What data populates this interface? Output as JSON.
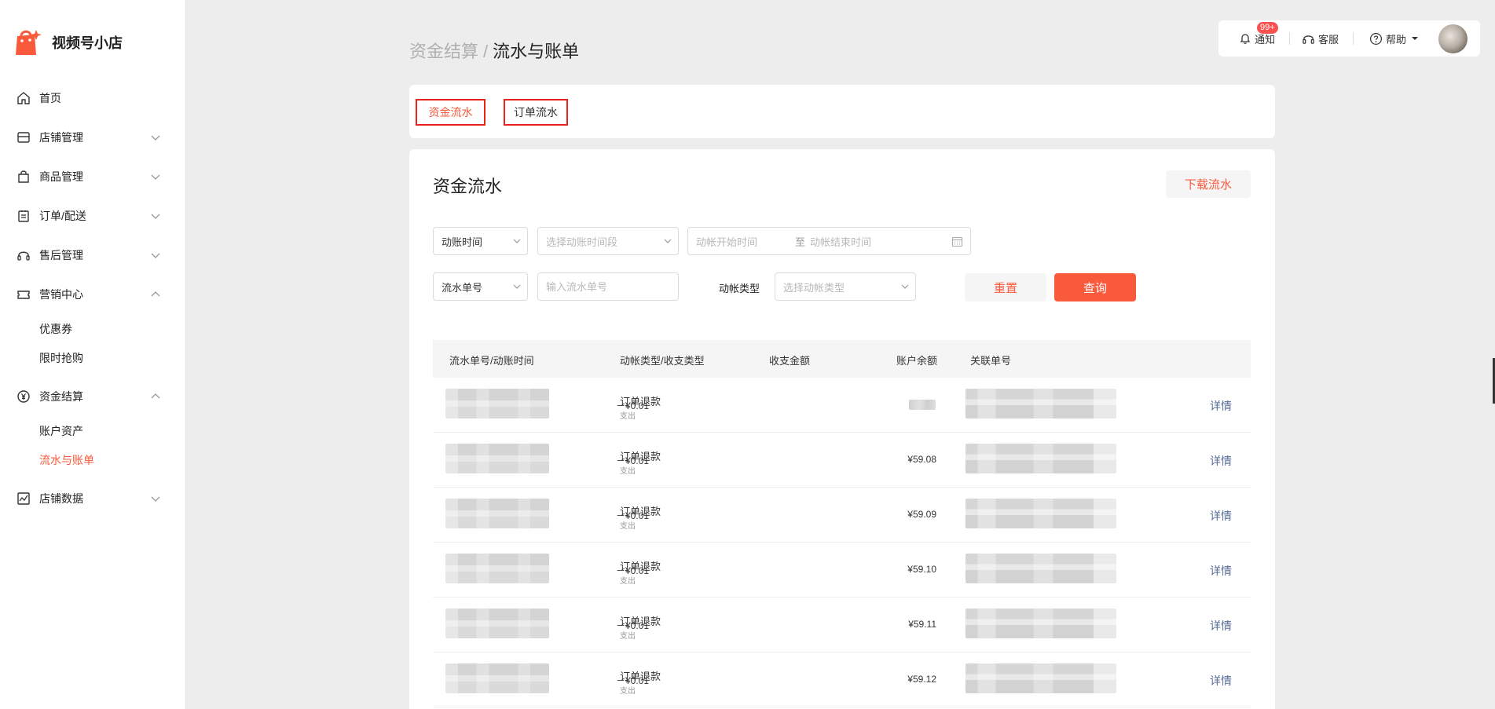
{
  "brand": {
    "name": "视频号小店"
  },
  "sidebar": {
    "items": [
      {
        "label": "首页",
        "icon": "home-icon"
      },
      {
        "label": "店铺管理",
        "icon": "store-icon",
        "expanded": false
      },
      {
        "label": "商品管理",
        "icon": "bag-icon",
        "expanded": false
      },
      {
        "label": "订单/配送",
        "icon": "clipboard-icon",
        "expanded": false
      },
      {
        "label": "售后管理",
        "icon": "headset-icon",
        "expanded": false
      },
      {
        "label": "营销中心",
        "icon": "ticket-icon",
        "expanded": true,
        "children": [
          "优惠券",
          "限时抢购"
        ]
      },
      {
        "label": "资金结算",
        "icon": "yen-icon",
        "expanded": true,
        "children": [
          "账户资产",
          "流水与账单"
        ],
        "active_child": "流水与账单"
      },
      {
        "label": "店铺数据",
        "icon": "chart-icon",
        "expanded": false
      }
    ]
  },
  "topbar": {
    "notify_label": "通知",
    "notify_badge": "99+",
    "service_label": "客服",
    "help_label": "帮助"
  },
  "breadcrumb": {
    "parent": "资金结算",
    "separator": "/",
    "current": "流水与账单"
  },
  "tabs": [
    {
      "label": "资金流水",
      "active": true
    },
    {
      "label": "订单流水",
      "active": false
    }
  ],
  "card": {
    "title": "资金流水",
    "download_label": "下载流水"
  },
  "filters": {
    "time_type": "动账时间",
    "time_range_placeholder": "选择动账时间段",
    "start_placeholder": "动帐开始时间",
    "range_sep": "至",
    "end_placeholder": "动帐结束时间",
    "id_type": "流水单号",
    "id_placeholder": "输入流水单号",
    "change_type_label": "动帐类型",
    "change_type_placeholder": "选择动帐类型",
    "reset_label": "重置",
    "query_label": "查询"
  },
  "table": {
    "headers": [
      "流水单号/动账时间",
      "动帐类型/收支类型",
      "收支金额",
      "账户余额",
      "关联单号"
    ],
    "rows": [
      {
        "type": "订单退款",
        "sub": "支出",
        "amount": "－¥0.01",
        "balance": "",
        "detail": "详情"
      },
      {
        "type": "订单退款",
        "sub": "支出",
        "amount": "－¥0.01",
        "balance": "¥59.08",
        "detail": "详情"
      },
      {
        "type": "订单退款",
        "sub": "支出",
        "amount": "－¥0.01",
        "balance": "¥59.09",
        "detail": "详情"
      },
      {
        "type": "订单退款",
        "sub": "支出",
        "amount": "－¥0.01",
        "balance": "¥59.10",
        "detail": "详情"
      },
      {
        "type": "订单退款",
        "sub": "支出",
        "amount": "－¥0.01",
        "balance": "¥59.11",
        "detail": "详情"
      },
      {
        "type": "订单退款",
        "sub": "支出",
        "amount": "－¥0.01",
        "balance": "¥59.12",
        "detail": "详情"
      }
    ]
  },
  "colors": {
    "accent": "#fa5a3c",
    "link": "#576b95",
    "highlight_box": "#e8231c"
  }
}
